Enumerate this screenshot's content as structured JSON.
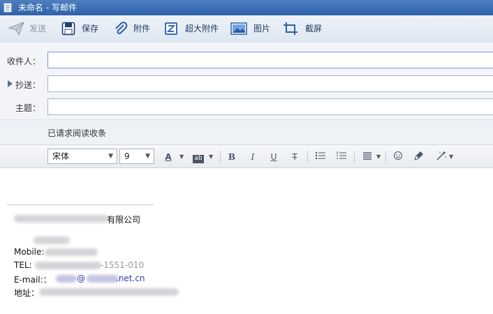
{
  "window": {
    "title": "未命名 - 写邮件"
  },
  "toolbar": {
    "send_label": "发送",
    "save_label": "保存",
    "attach_label": "附件",
    "large_attach_label": "超大附件",
    "image_label": "图片",
    "screenshot_label": "截屏"
  },
  "fields": {
    "to_label": "收件人：",
    "cc_label": "抄送：",
    "subject_label": "主题：",
    "to_value": "",
    "cc_value": "",
    "subject_value": ""
  },
  "receipt": {
    "text": "已请求阅读收条"
  },
  "format": {
    "font_family": "宋体",
    "font_size": "9",
    "font_color_glyph": "A",
    "highlight_glyph": "ab",
    "bold_glyph": "B",
    "italic_glyph": "I",
    "underline_glyph": "U",
    "strike_glyph": "T"
  },
  "signature": {
    "company_suffix": "有限公司",
    "mobile_label": "Mobile:",
    "tel_label": "TEL:",
    "tel_visible": "-1551-010",
    "email_label": "E-mail:",
    "email_colon": "：",
    "email_at": "@",
    "email_domain": ".net.cn",
    "address_label": "地址："
  },
  "colors": {
    "titlebar": "#2f62aa",
    "toolbar_text": "#1e3a5f",
    "link": "#2a3fb0"
  },
  "icons": [
    "document-icon",
    "send-icon",
    "save-icon",
    "paperclip-icon",
    "large-attachment-icon",
    "image-icon",
    "screenshot-icon",
    "bullet-list-icon",
    "numbered-list-icon",
    "align-icon",
    "emoji-icon",
    "format-painter-icon",
    "magic-wand-icon"
  ]
}
